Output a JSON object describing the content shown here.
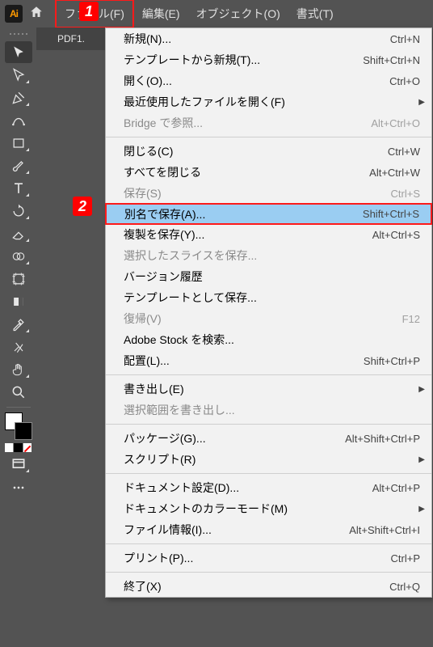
{
  "menubar": {
    "logo_text": "Ai",
    "items": [
      "ファイル(F)",
      "編集(E)",
      "オブジェクト(O)",
      "書式(T)"
    ]
  },
  "callouts": {
    "one": "1",
    "two": "2"
  },
  "tab": {
    "name": "PDF1."
  },
  "dropdown": {
    "groups": [
      [
        {
          "label": "新規(N)...",
          "shortcut": "Ctrl+N",
          "disabled": false
        },
        {
          "label": "テンプレートから新規(T)...",
          "shortcut": "Shift+Ctrl+N",
          "disabled": false
        },
        {
          "label": "開く(O)...",
          "shortcut": "Ctrl+O",
          "disabled": false
        },
        {
          "label": "最近使用したファイルを開く(F)",
          "submenu": true,
          "disabled": false
        },
        {
          "label": "Bridge で参照...",
          "shortcut": "Alt+Ctrl+O",
          "disabled": true
        }
      ],
      [
        {
          "label": "閉じる(C)",
          "shortcut": "Ctrl+W",
          "disabled": false
        },
        {
          "label": "すべてを閉じる",
          "shortcut": "Alt+Ctrl+W",
          "disabled": false
        },
        {
          "label": "保存(S)",
          "shortcut": "Ctrl+S",
          "disabled": true
        },
        {
          "label": "別名で保存(A)...",
          "shortcut": "Shift+Ctrl+S",
          "disabled": false,
          "hl": true
        },
        {
          "label": "複製を保存(Y)...",
          "shortcut": "Alt+Ctrl+S",
          "disabled": false
        },
        {
          "label": "選択したスライスを保存...",
          "disabled": true
        },
        {
          "label": "バージョン履歴",
          "disabled": false
        },
        {
          "label": "テンプレートとして保存...",
          "disabled": false
        },
        {
          "label": "復帰(V)",
          "shortcut": "F12",
          "disabled": true
        },
        {
          "label": "Adobe Stock を検索...",
          "disabled": false
        },
        {
          "label": "配置(L)...",
          "shortcut": "Shift+Ctrl+P",
          "disabled": false
        }
      ],
      [
        {
          "label": "書き出し(E)",
          "submenu": true,
          "disabled": false
        },
        {
          "label": "選択範囲を書き出し...",
          "disabled": true
        }
      ],
      [
        {
          "label": "パッケージ(G)...",
          "shortcut": "Alt+Shift+Ctrl+P",
          "disabled": false
        },
        {
          "label": "スクリプト(R)",
          "submenu": true,
          "disabled": false
        }
      ],
      [
        {
          "label": "ドキュメント設定(D)...",
          "shortcut": "Alt+Ctrl+P",
          "disabled": false
        },
        {
          "label": "ドキュメントのカラーモード(M)",
          "submenu": true,
          "disabled": false
        },
        {
          "label": "ファイル情報(I)...",
          "shortcut": "Alt+Shift+Ctrl+I",
          "disabled": false
        }
      ],
      [
        {
          "label": "プリント(P)...",
          "shortcut": "Ctrl+P",
          "disabled": false
        }
      ],
      [
        {
          "label": "終了(X)",
          "shortcut": "Ctrl+Q",
          "disabled": false
        }
      ]
    ]
  },
  "tools": [
    {
      "name": "selection-tool",
      "corner": false
    },
    {
      "name": "direct-selection-tool",
      "corner": true
    },
    {
      "name": "pen-tool",
      "corner": true
    },
    {
      "name": "curvature-tool",
      "corner": false
    },
    {
      "name": "rectangle-tool",
      "corner": true
    },
    {
      "name": "paintbrush-tool",
      "corner": true
    },
    {
      "name": "type-tool",
      "corner": true
    },
    {
      "name": "rotate-tool",
      "corner": true
    },
    {
      "name": "eraser-tool",
      "corner": true
    },
    {
      "name": "shape-builder-tool",
      "corner": true
    },
    {
      "name": "artboard-tool",
      "corner": false
    },
    {
      "name": "gradient-tool",
      "corner": false
    },
    {
      "name": "eyedropper-tool",
      "corner": true
    },
    {
      "name": "scissors-tool",
      "corner": false
    },
    {
      "name": "hand-tool",
      "corner": true
    },
    {
      "name": "zoom-tool",
      "corner": false
    }
  ]
}
